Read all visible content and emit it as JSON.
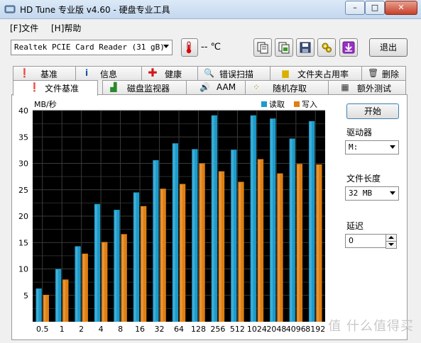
{
  "window": {
    "title": "HD Tune 专业版 v4.60 - 硬盘专业工具",
    "minimize": "–",
    "maximize": "□",
    "close": "✕"
  },
  "menu": [
    {
      "label": "[F]文件"
    },
    {
      "label": "[H]帮助"
    }
  ],
  "toolbar": {
    "drive_selected": "Realtek PCIE Card Reader (31 gB)",
    "temperature": "-- ℃",
    "exit_label": "退出",
    "icons": [
      "copy-text-icon",
      "copy-screenshot-icon",
      "save-icon",
      "options-icon",
      "download-icon"
    ]
  },
  "tabs_row1": [
    {
      "label": "基准",
      "icon": "info"
    },
    {
      "label": "信息",
      "icon": "info"
    },
    {
      "label": "健康",
      "icon": "cross"
    },
    {
      "label": "错误扫描",
      "icon": "magnifier"
    },
    {
      "label": "文件夹占用率",
      "icon": "folder"
    },
    {
      "label": "删除",
      "icon": "trash"
    }
  ],
  "tabs_row2": [
    {
      "label": "文件基准",
      "icon": "file",
      "active": true
    },
    {
      "label": "磁盘监视器",
      "icon": "chart"
    },
    {
      "label": "AAM",
      "icon": "speaker"
    },
    {
      "label": "随机存取",
      "icon": "dots"
    },
    {
      "label": "额外测试",
      "icon": "grid"
    }
  ],
  "side": {
    "start_label": "开始",
    "drive_label": "驱动器",
    "drive_value": "M:",
    "file_length_label": "文件长度",
    "file_length_value": "32 MB",
    "delay_label": "延迟",
    "delay_value": "0"
  },
  "watermark": "值 什么值得买",
  "chart_data": {
    "type": "bar",
    "ylabel": "MB/秒",
    "ylim": [
      0,
      40
    ],
    "yticks": [
      5,
      10,
      15,
      20,
      25,
      30,
      35,
      40
    ],
    "categories": [
      "0.5",
      "1",
      "2",
      "4",
      "8",
      "16",
      "32",
      "64",
      "128",
      "256",
      "512",
      "1024",
      "2048",
      "4096",
      "8192"
    ],
    "series": [
      {
        "name": "读取",
        "color": "#1a9ccc",
        "values": [
          6.3,
          10,
          14.3,
          22.3,
          21.2,
          24.5,
          30.6,
          33.8,
          32.7,
          39.1,
          32.6,
          39.1,
          38.5,
          34.7,
          38
        ]
      },
      {
        "name": "写入",
        "color": "#e07f10",
        "values": [
          5.1,
          8,
          12.9,
          15.1,
          16.6,
          21.9,
          25.2,
          26.1,
          30,
          28.5,
          26.5,
          30.8,
          28.1,
          29.9,
          29.8
        ]
      }
    ],
    "grid": true,
    "legend": "top-right"
  }
}
